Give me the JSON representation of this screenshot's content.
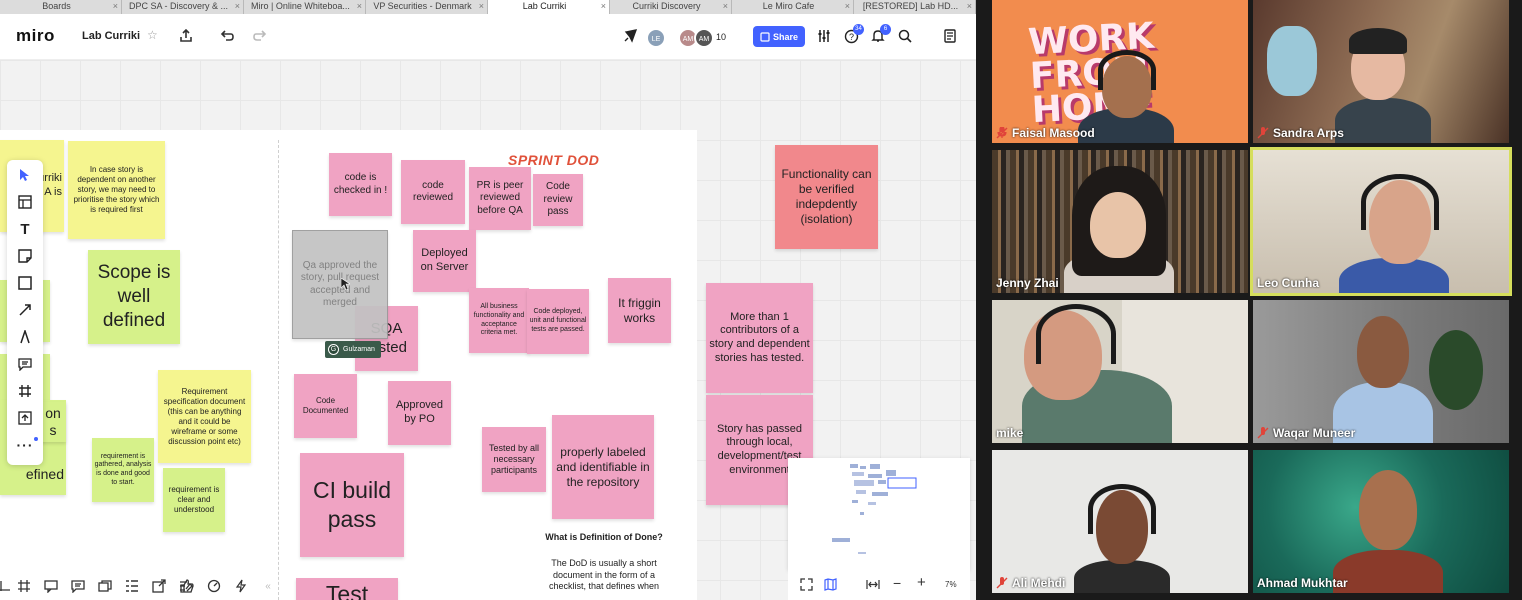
{
  "browser": {
    "tabs": [
      {
        "label": "Boards"
      },
      {
        "label": "DPC SA - Discovery & ..."
      },
      {
        "label": "Miro | Online Whiteboa..."
      },
      {
        "label": "VP Securities - Denmark"
      },
      {
        "label": "Lab Curriki"
      },
      {
        "label": "Curriki Discovery"
      },
      {
        "label": "Le Miro Cafe"
      },
      {
        "label": "[RESTORED] Lab HD..."
      }
    ],
    "active_tab_index": 4
  },
  "toolbar": {
    "logo": "miro",
    "board_name": "Lab Curriki",
    "star_icon": "star-icon",
    "collaborator_initials": [
      "LE",
      "AM",
      "AM"
    ],
    "collaborator_count": "10",
    "share_label": "Share",
    "help_badge": "34",
    "notification_badge": "6",
    "accent_color": "#4262ff"
  },
  "canvas": {
    "sprint_dod_title": "SPRINT DOD",
    "cursor_user": {
      "initial": "G",
      "name": "Gulzaman"
    },
    "stickies": {
      "story_dependent": "In case story is dependent on another story, we may need to prioritise the story which is required first",
      "left_cut_1": "reat Curriki eo in A is",
      "scope": "Scope is well defined",
      "requirement_spec": "Requirement specification document (this can be anything and it could be wireframe or some discussion point etc)",
      "requirement_gathered": "requirement is gathered, analysis is done and good to start.",
      "requirement_clear": "requirement is clear and understood",
      "left_cut_2": "on s",
      "left_cut_3": "efined",
      "code_checked": "code is checked in !",
      "code_reviewed": "code reviewed",
      "pr_reviewed": "PR is peer reviewed before QA",
      "code_review_pass": "Code review pass",
      "qa_approved": "Qa approved the story, pull request accepted and merged",
      "deployed": "Deployed on Server",
      "sqa_tested": "SQA tested",
      "business_functionality": "All business functionality and acceptance criteria met.",
      "code_deployed_tests": "Code deployed, unit and functional tests are passed.",
      "friggin_works": "It friggin works",
      "code_documented": "Code Documented",
      "approved_po": "Approved by PO",
      "ci_build": "CI build pass",
      "tested_by_all": "Tested by all necessary participants",
      "properly_labeled": "properly labeled and identifiable in the repository",
      "test_partial": "Test",
      "functionality_verified": "Functionality can be verified indepdently (isolation)",
      "more_than_1": "More than 1 contributors of a story and dependent stories has tested.",
      "story_passed": "Story has passed through local, development/test environment"
    },
    "dod_question": "What is Definition of Done?",
    "dod_text": "The DoD is usually a short document in the form of a checklist, that defines when"
  },
  "minimap": {
    "zoom_level": "7%"
  },
  "participants": [
    {
      "name": "Faisal Masood",
      "muted": true
    },
    {
      "name": "Sandra Arps",
      "muted": true
    },
    {
      "name": "Jenny Zhai",
      "muted": false
    },
    {
      "name": "Leo Cunha",
      "muted": false,
      "active_speaker": true
    },
    {
      "name": "mike",
      "muted": false
    },
    {
      "name": "Waqar Muneer",
      "muted": true
    },
    {
      "name": "Ali Mehdi",
      "muted": true
    },
    {
      "name": "Ahmad Mukhtar",
      "muted": false
    }
  ],
  "backgrounds": {
    "faisal_banner": "WORK FROM HOME"
  }
}
